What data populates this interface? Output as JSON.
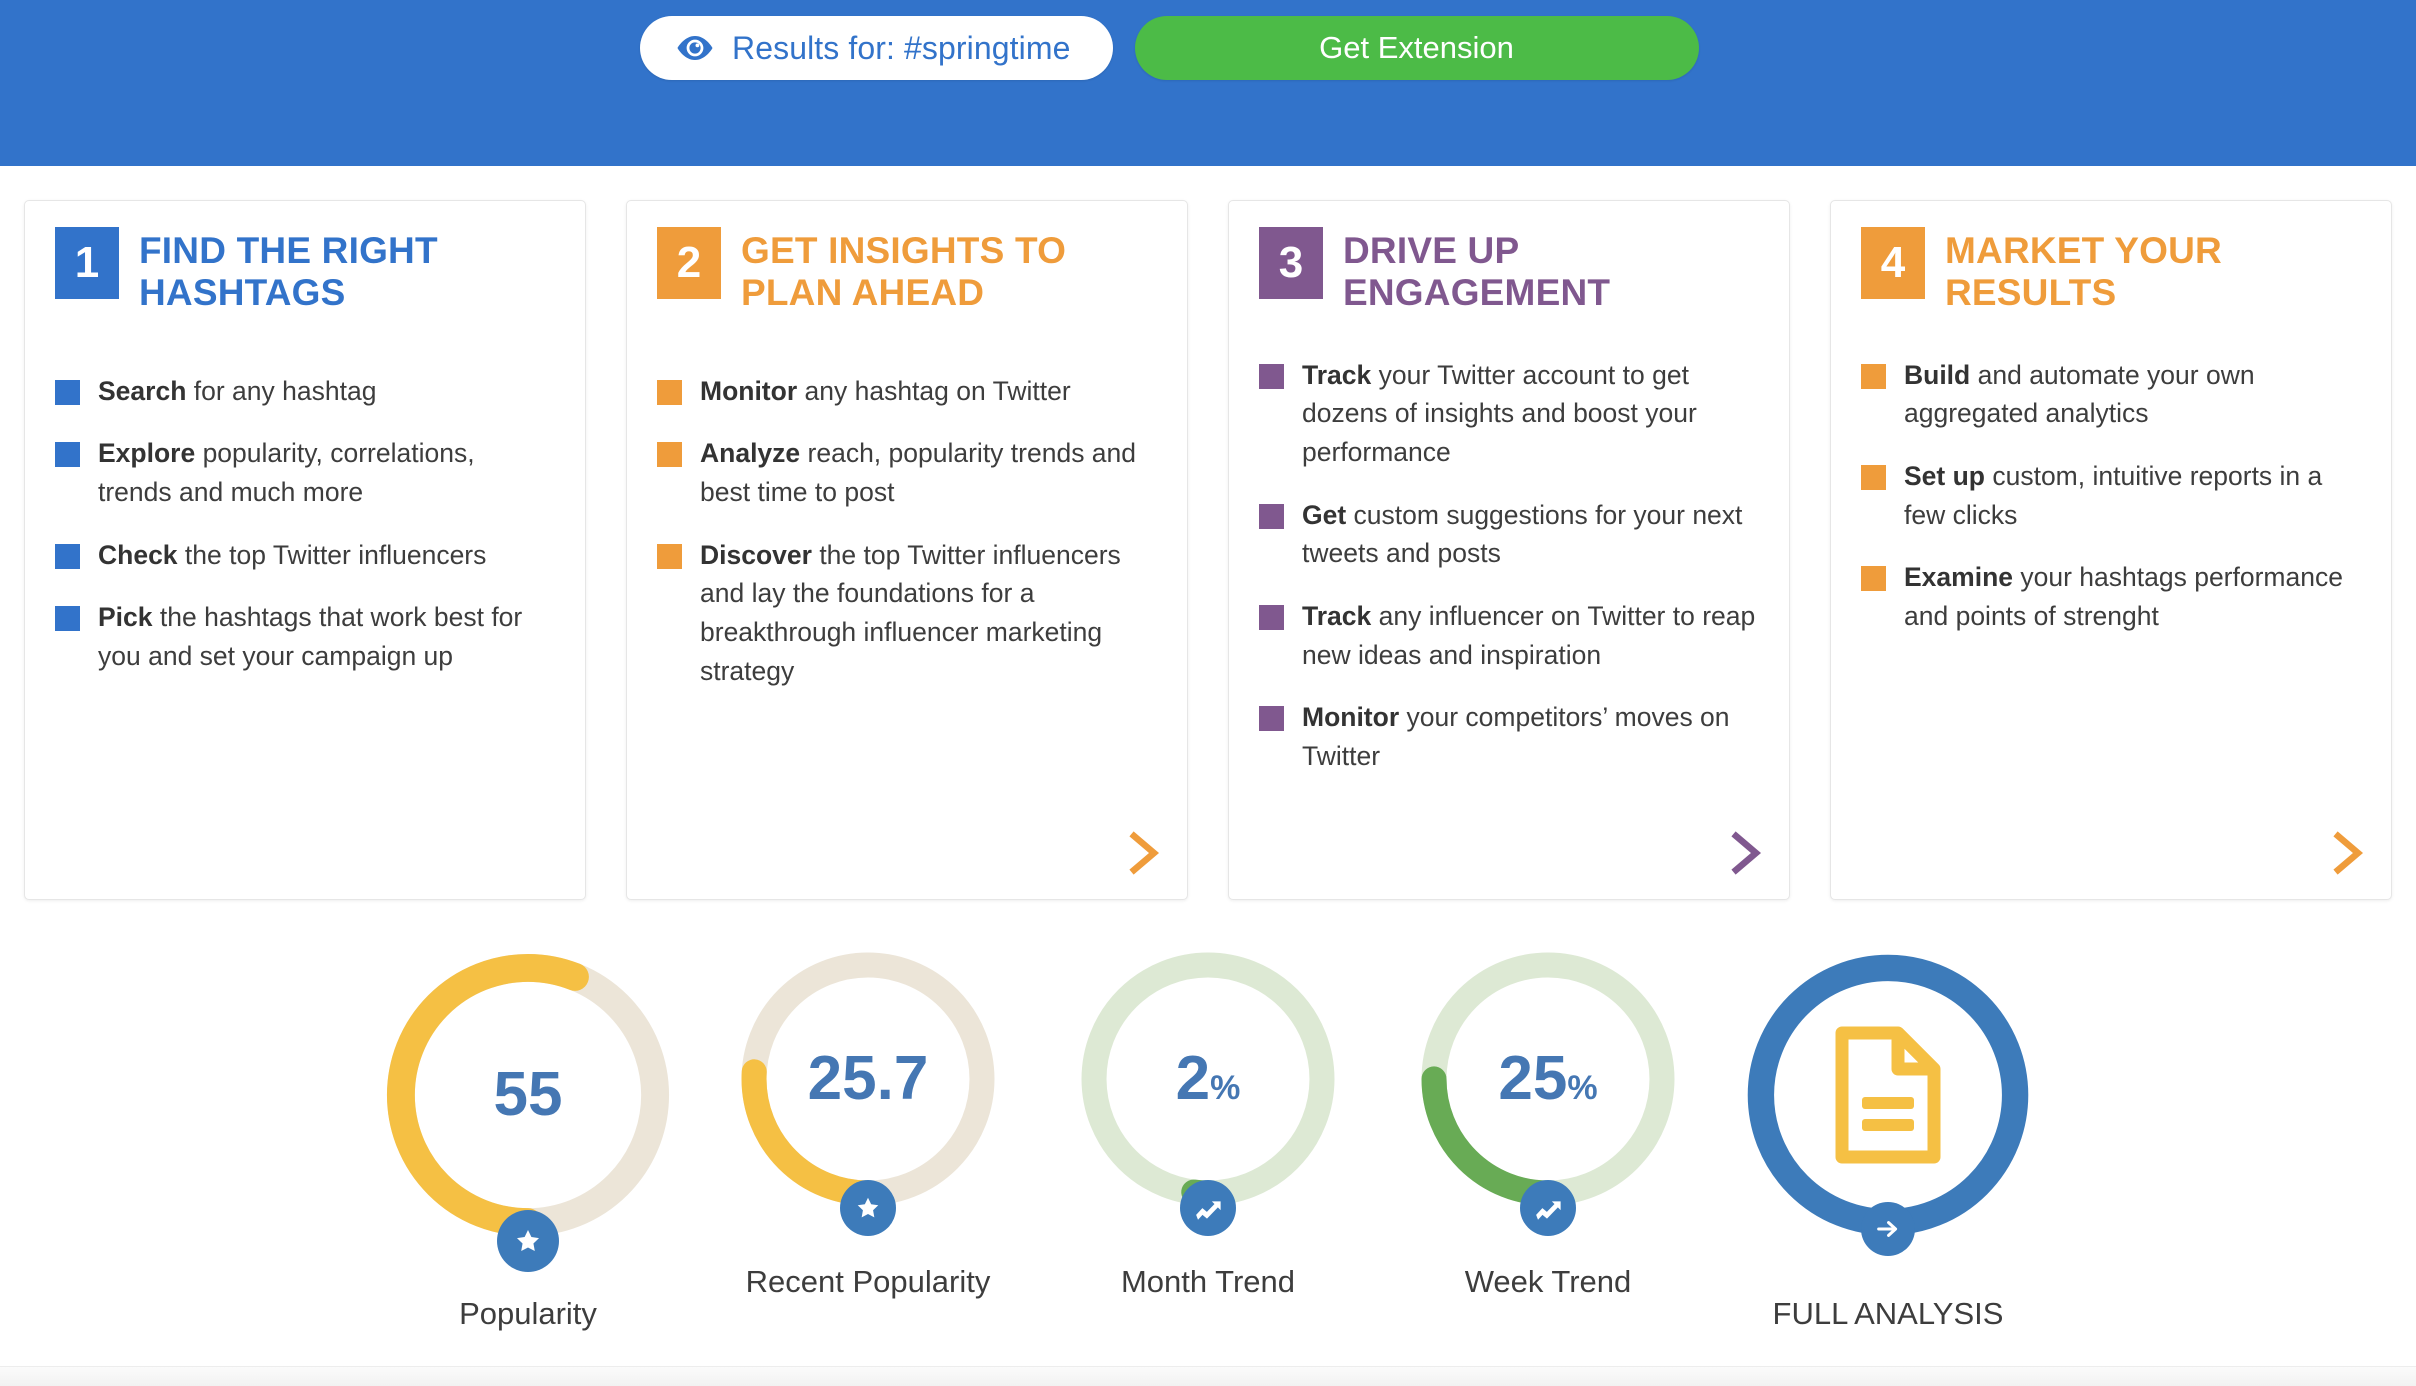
{
  "header": {
    "results_label": "Results for: #springtime",
    "eye_icon": "eye-icon",
    "get_extension_label": "Get Extension",
    "bar_color": "#3273ca",
    "button_color": "#4cbb47",
    "pill_text_color": "#3273ca"
  },
  "cards": [
    {
      "number": "1",
      "title": "FIND THE RIGHT HASHTAGS",
      "color": "#3273ca",
      "has_arrow": false,
      "bullets": [
        {
          "strong": "Search",
          "rest": " for any hashtag"
        },
        {
          "strong": "Explore",
          "rest": " popularity, correlations, trends and much more"
        },
        {
          "strong": "Check",
          "rest": " the top Twitter influencers"
        },
        {
          "strong": "Pick",
          "rest": " the hashtags that work best for you and set your campaign up"
        }
      ]
    },
    {
      "number": "2",
      "title": "GET INSIGHTS TO PLAN AHEAD",
      "color": "#ef9c3b",
      "has_arrow": true,
      "bullets": [
        {
          "strong": "Monitor",
          "rest": " any hashtag on Twitter"
        },
        {
          "strong": "Analyze",
          "rest": " reach, popularity trends and best time to post"
        },
        {
          "strong": "Discover",
          "rest": " the top Twitter influencers and lay the foundations for a breakthrough influencer marketing strategy"
        }
      ]
    },
    {
      "number": "3",
      "title": "DRIVE UP ENGAGEMENT",
      "color": "#80588f",
      "has_arrow": true,
      "bullets": [
        {
          "strong": "Track",
          "rest": " your Twitter account to get dozens of insights and boost your performance"
        },
        {
          "strong": "Get",
          "rest": " custom suggestions for your next tweets and posts"
        },
        {
          "strong": "Track",
          "rest": " any influencer on Twitter to reap new ideas and inspiration"
        },
        {
          "strong": "Monitor",
          "rest": " your competitors’ moves on Twitter"
        }
      ]
    },
    {
      "number": "4",
      "title": "MARKET YOUR RESULTS",
      "color": "#ef9c3b",
      "has_arrow": true,
      "bullets": [
        {
          "strong": "Build",
          "rest": " and automate your own aggregated analytics"
        },
        {
          "strong": "Set up",
          "rest": " custom, intuitive reports in a few clicks"
        },
        {
          "strong": "Examine",
          "rest": " your hashtags performance and points of strenght"
        }
      ]
    }
  ],
  "metrics": [
    {
      "label": "Popularity",
      "value": "55",
      "suffix": "",
      "percent": 56,
      "arc_color": "#f5c044",
      "track_color": "#ece5d8",
      "badge_icon": "star-icon",
      "badge_color": "#3d7bba"
    },
    {
      "label": "Recent Popularity",
      "value": "25.7",
      "suffix": "",
      "percent": 26,
      "arc_color": "#f5c044",
      "track_color": "#ece5d8",
      "badge_icon": "star-icon",
      "badge_color": "#3d7bba"
    },
    {
      "label": "Month Trend",
      "value": "2",
      "suffix": "%",
      "percent": 2,
      "arc_color": "#68ab55",
      "track_color": "#dde9d4",
      "badge_icon": "trend-up-icon",
      "badge_color": "#3d7bba"
    },
    {
      "label": "Week Trend",
      "value": "25",
      "suffix": "%",
      "percent": 25,
      "arc_color": "#68ab55",
      "track_color": "#dde9d4",
      "badge_icon": "trend-up-icon",
      "badge_color": "#3d7bba"
    }
  ],
  "full_analysis": {
    "label": "FULL ANALYSIS",
    "ring_color": "#3d7bba",
    "doc_icon": "document-icon",
    "doc_color": "#f5c044",
    "badge_icon": "arrow-right-icon",
    "badge_color": "#3d7bba"
  },
  "chart_data": {
    "type": "table",
    "title": "Hashtag metrics for #springtime",
    "categories": [
      "Popularity",
      "Recent Popularity",
      "Month Trend",
      "Week Trend"
    ],
    "values": [
      55,
      25.7,
      2,
      25
    ],
    "units": [
      "score",
      "score",
      "%",
      "%"
    ],
    "ring_fill_percent": [
      56,
      26,
      2,
      25
    ],
    "ylim": [
      0,
      100
    ],
    "legend": "none",
    "grid": false
  }
}
